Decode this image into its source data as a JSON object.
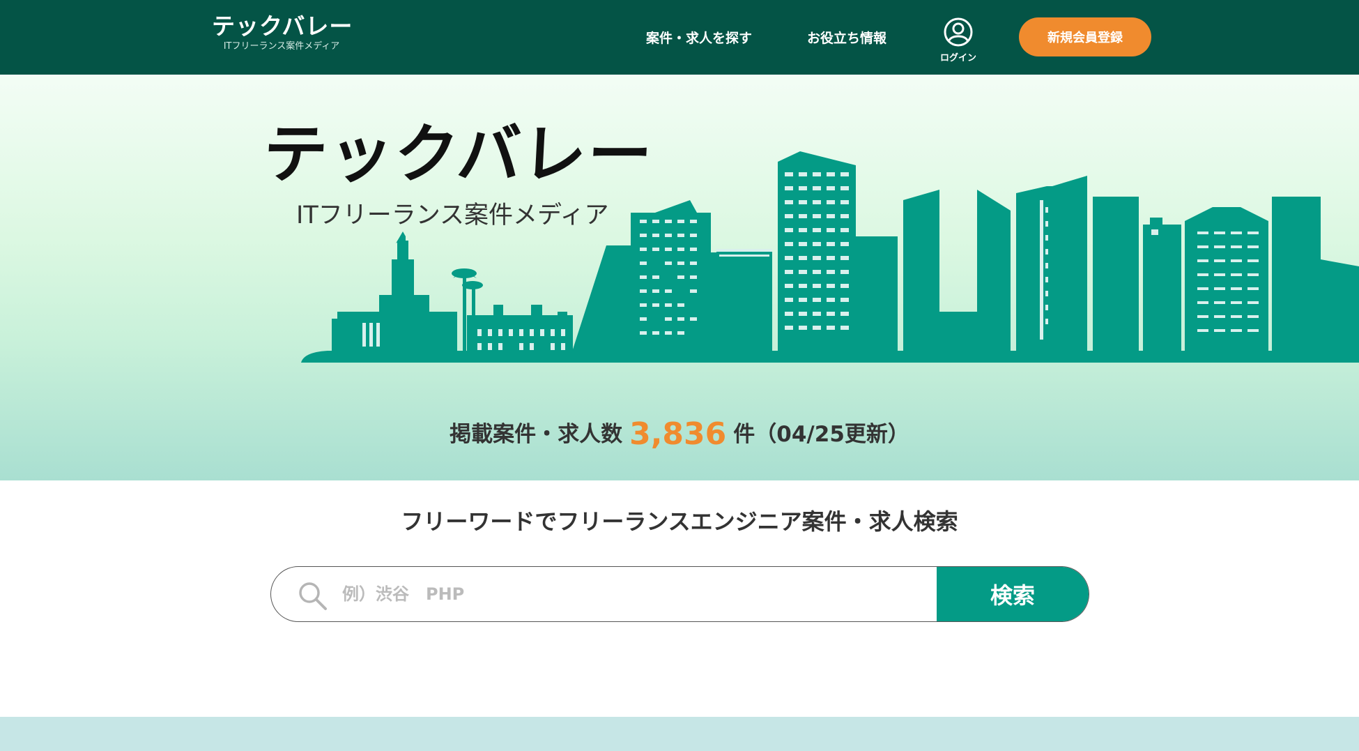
{
  "header": {
    "logo_title": "テックバレー",
    "logo_subtitle": "ITフリーランス案件メディア",
    "nav": {
      "find_jobs": "案件・求人を探す",
      "useful_info": "お役立ち情報",
      "login": "ログイン",
      "register": "新規会員登録"
    }
  },
  "hero": {
    "title": "テックバレー",
    "subtitle": "ITフリーランス案件メディア",
    "count_prefix": "掲載案件・求人数",
    "count_value": "3,836",
    "count_suffix": "件（04/25更新）"
  },
  "search": {
    "heading": "フリーワードでフリーランスエンジニア案件・求人検索",
    "placeholder": "例）渋谷　PHP",
    "value": "",
    "button": "検索"
  },
  "icons": {
    "search": "search-icon",
    "user": "user-icon"
  },
  "colors": {
    "header_bg": "#045446",
    "accent_orange": "#f08b2e",
    "skyline_teal": "#049b86",
    "search_button": "#049b86"
  }
}
